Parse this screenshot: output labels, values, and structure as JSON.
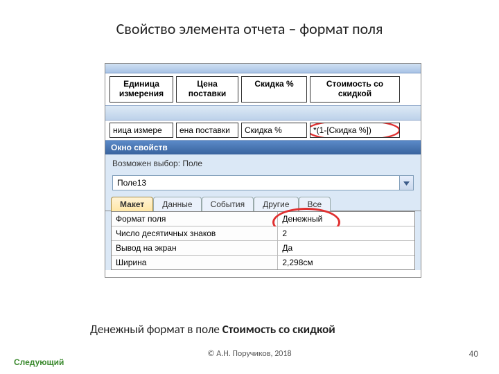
{
  "slide": {
    "title": "Свойство элемента отчета – формат поля",
    "caption_plain": "Денежный формат в поле ",
    "caption_bold": "Стоимость со скидкой",
    "next": "Следующий",
    "copyright": "© А.Н. Поручиков, 2018",
    "page": "40"
  },
  "headers": {
    "c1": "Единица измерения",
    "c2": "Цена поставки",
    "c3": "Скидка %",
    "c4": "Стоимость со скидкой"
  },
  "cells": {
    "c1": "ница измере",
    "c2": "ена поставки",
    "c3": "Скидка %",
    "c4": "*(1-[Скидка %])"
  },
  "prop": {
    "window_title": "Окно свойств",
    "subtitle": "Возможен выбор:  Поле",
    "selected_field": "Поле13",
    "tabs": {
      "t1": "Макет",
      "t2": "Данные",
      "t3": "События",
      "t4": "Другие",
      "t5": "Все"
    },
    "rows": {
      "r1l": "Формат поля",
      "r1v": "Денежный",
      "r2l": "Число десятичных знаков",
      "r2v": "2",
      "r3l": "Вывод на экран",
      "r3v": "Да",
      "r4l": "Ширина",
      "r4v": "2,298см"
    }
  }
}
